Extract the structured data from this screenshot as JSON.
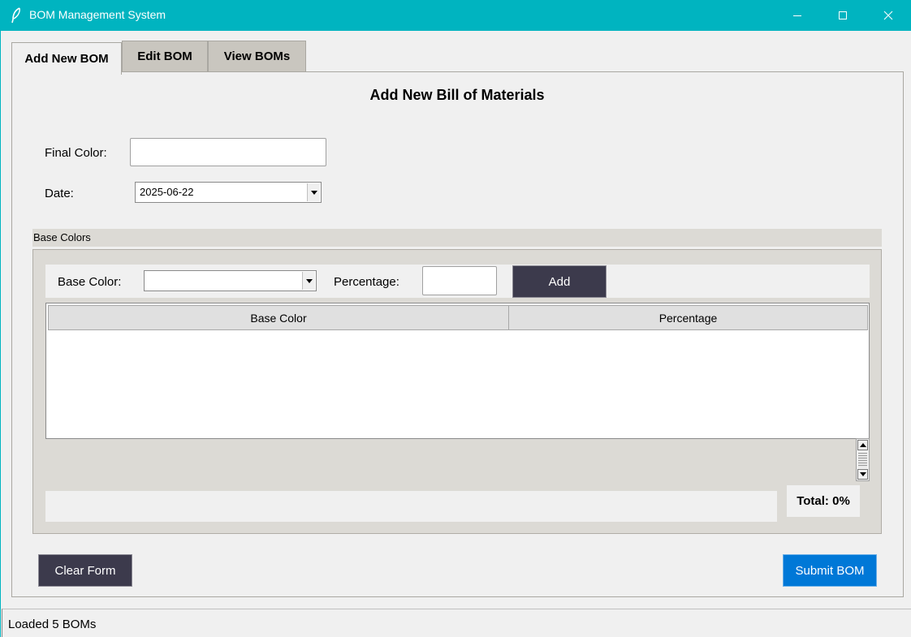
{
  "window": {
    "title": "BOM Management System",
    "titlebar_color": "#00b4c0"
  },
  "tabs": [
    {
      "label": "Add New BOM",
      "active": true
    },
    {
      "label": "Edit BOM",
      "active": false
    },
    {
      "label": "View BOMs",
      "active": false
    }
  ],
  "form": {
    "heading": "Add New Bill of Materials",
    "final_color_label": "Final Color:",
    "final_color_value": "",
    "date_label": "Date:",
    "date_value": "2025-06-22"
  },
  "base_colors": {
    "group_label": "Base Colors",
    "base_color_label": "Base Color:",
    "base_color_value": "",
    "percentage_label": "Percentage:",
    "percentage_value": "",
    "add_label": "Add",
    "columns": [
      "Base Color",
      "Percentage"
    ],
    "rows": [],
    "total_label": "Total: 0%"
  },
  "actions": {
    "clear_label": "Clear Form",
    "submit_label": "Submit BOM",
    "dark_button_color": "#3c3a4c",
    "submit_color": "#0078d7"
  },
  "status": {
    "text": "Loaded 5 BOMs"
  }
}
